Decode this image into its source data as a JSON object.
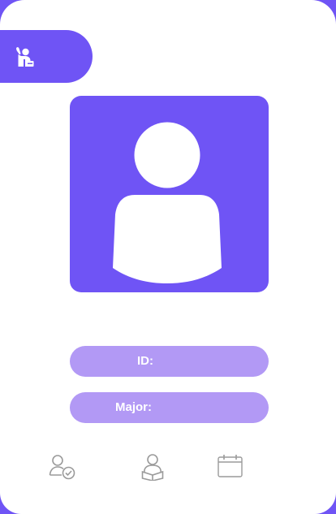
{
  "header": {
    "badge_icon": "raised-hand-icon"
  },
  "profile": {
    "avatar_icon": "user-silhouette-icon",
    "id_label": "ID:",
    "id_value": "",
    "major_label": "Major:",
    "major_value": ""
  },
  "bottom_nav": {
    "items": [
      {
        "icon": "user-check-icon"
      },
      {
        "icon": "user-reading-icon"
      },
      {
        "icon": "calendar-icon"
      }
    ]
  },
  "colors": {
    "accent": "#6f54f5",
    "field_fill": "#b299f5",
    "nav_icon": "#9a9a9a"
  }
}
